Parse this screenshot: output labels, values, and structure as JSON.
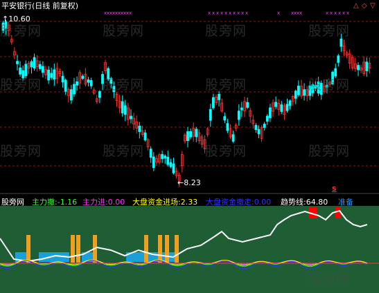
{
  "header": {
    "title": "平安银行(日线 前复权)",
    "sub_price": "10.60",
    "low_label": "8.23",
    "colors": {
      "title": "#ffffff",
      "sub": "#ffffff"
    }
  },
  "controls": {
    "up": "△",
    "diamond": "◇",
    "down": "▽"
  },
  "marker": "s",
  "watermarks": [
    "股旁网",
    "股旁网",
    "股旁网",
    "股旁网",
    "股旁网",
    "股旁网",
    "股旁网",
    "股旁网",
    "股旁网",
    "股旁网",
    "股旁网",
    "股旁网",
    "股旁网"
  ],
  "indicator": {
    "items": [
      {
        "label": "股旁网",
        "value": "",
        "color": "#ffffff"
      },
      {
        "label": "主力撤:",
        "value": "-1.16",
        "color": "#33ff33"
      },
      {
        "label": "主力进:",
        "value": "0.00",
        "color": "#ff33ff"
      },
      {
        "label": "大盘资金进场:",
        "value": "2.33",
        "color": "#ffff00"
      },
      {
        "label": "大盘资金撤走:",
        "value": "0.00",
        "color": "#3333ff"
      },
      {
        "label": "趋势线:",
        "value": "64.80",
        "color": "#ffffff"
      },
      {
        "label": "准备",
        "value": "",
        "color": "#1e90ff"
      }
    ]
  },
  "colors": {
    "up": "#ff3232",
    "down": "#00ffff",
    "panel": "#1f5e34",
    "grid": "#8a1b1b",
    "bar_blue": "#1aa0d8",
    "bar_orange": "#f0a020"
  }
}
